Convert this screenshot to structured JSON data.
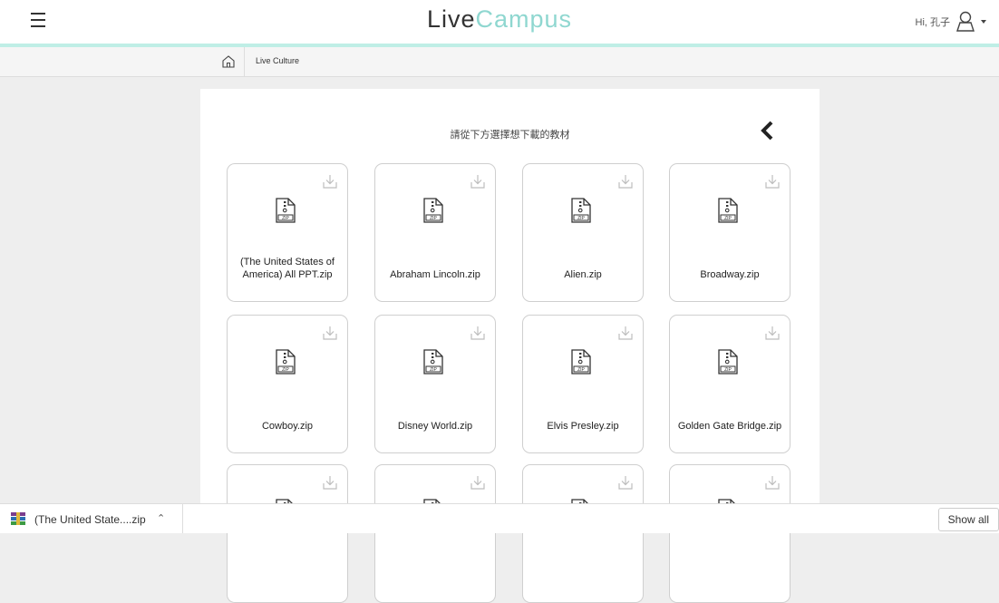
{
  "header": {
    "logo_part1": "Live",
    "logo_part2": "Campus",
    "greeting": "Hi, 孔子",
    "accent_color": "#bfeee6"
  },
  "breadcrumb": {
    "home_icon": "home-icon",
    "label": "Live Culture"
  },
  "main": {
    "title": "請從下方選擇想下載的教材",
    "files": [
      {
        "name": "(The United States of America) All PPT.zip"
      },
      {
        "name": "Abraham Lincoln.zip"
      },
      {
        "name": "Alien.zip"
      },
      {
        "name": "Broadway.zip"
      },
      {
        "name": "Cowboy.zip"
      },
      {
        "name": "Disney World.zip"
      },
      {
        "name": "Elvis Presley.zip"
      },
      {
        "name": "Golden Gate Bridge.zip"
      },
      {
        "name": ""
      },
      {
        "name": ""
      },
      {
        "name": ""
      },
      {
        "name": ""
      }
    ]
  },
  "download_bar": {
    "item_name": "(The United State....zip",
    "show_all": "Show all"
  }
}
